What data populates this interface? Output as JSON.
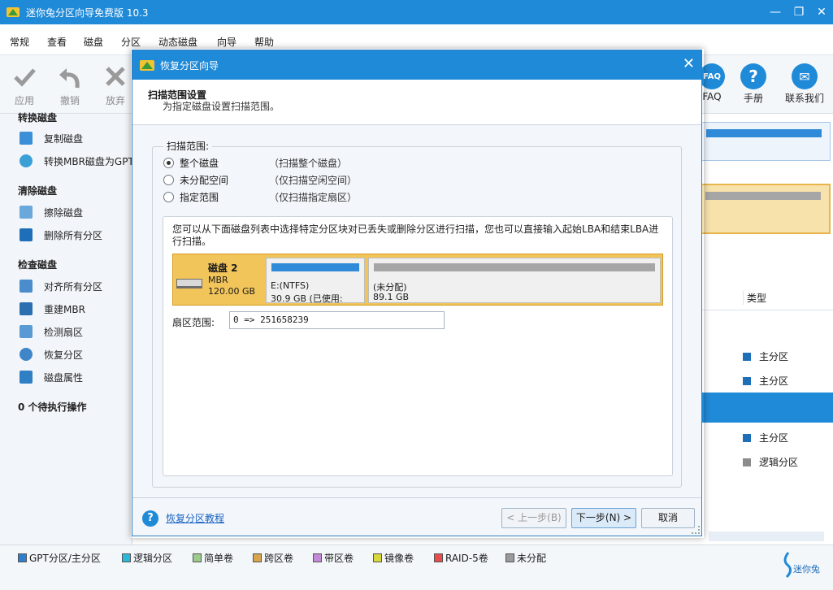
{
  "app": {
    "title": "迷你兔分区向导免费版 10.3",
    "brand_color": "#1f8ad8"
  },
  "menu": [
    "常规",
    "查看",
    "磁盘",
    "分区",
    "动态磁盘",
    "向导",
    "帮助"
  ],
  "toolbar": {
    "left": [
      {
        "label": "应用",
        "icon": "check-icon"
      },
      {
        "label": "撤销",
        "icon": "undo-icon"
      },
      {
        "label": "放弃",
        "icon": "discard-icon"
      }
    ],
    "right": [
      {
        "label": "FAQ",
        "icon": "faq-icon"
      },
      {
        "label": "手册",
        "icon": "help-icon"
      },
      {
        "label": "联系我们",
        "icon": "mail-icon"
      }
    ]
  },
  "left_panel": {
    "group_convert": "转换磁盘",
    "items_convert": [
      "复制磁盘",
      "转换MBR磁盘为GPT"
    ],
    "group_clean": "清除磁盘",
    "items_clean": [
      "擦除磁盘",
      "删除所有分区"
    ],
    "group_check": "检查磁盘",
    "items_check": [
      "对齐所有分区",
      "重建MBR",
      "检测扇区",
      "恢复分区",
      "磁盘属性"
    ],
    "pending": "0 个待执行操作"
  },
  "right_table": {
    "header_type": "类型",
    "rows": [
      {
        "type": "主分区",
        "color": "#1f6fb8"
      },
      {
        "type": "主分区",
        "color": "#1f6fb8"
      },
      {
        "type": "主分区",
        "color": "#1f6fb8"
      },
      {
        "type": "逻辑分区",
        "color": "#8c8c8c"
      }
    ]
  },
  "legend": [
    {
      "label": "GPT分区/主分区",
      "color": "#2f7fd0"
    },
    {
      "label": "逻辑分区",
      "color": "#2bb8d8"
    },
    {
      "label": "简单卷",
      "color": "#9ccc8c"
    },
    {
      "label": "跨区卷",
      "color": "#d6a54c"
    },
    {
      "label": "带区卷",
      "color": "#c38ad8"
    },
    {
      "label": "镜像卷",
      "color": "#d8d83a"
    },
    {
      "label": "RAID-5卷",
      "color": "#e84c4c"
    },
    {
      "label": "未分配",
      "color": "#9a9a9a"
    }
  ],
  "dialog": {
    "title": "恢复分区向导",
    "header_title": "扫描范围设置",
    "header_desc": "为指定磁盘设置扫描范围。",
    "scan_range_label": "扫描范围:",
    "options": [
      {
        "label": "整个磁盘",
        "desc": "（扫描整个磁盘）",
        "selected": true
      },
      {
        "label": "未分配空间",
        "desc": "（仅扫描空闲空间）",
        "selected": false
      },
      {
        "label": "指定范围",
        "desc": "（仅扫描指定扇区）",
        "selected": false
      }
    ],
    "info_text": "您可以从下面磁盘列表中选择特定分区块对已丢失或删除分区进行扫描，您也可以直接输入起始LBA和结束LBA进行扫描。",
    "disk": {
      "name": "磁盘 2",
      "type": "MBR",
      "size": "120.00 GB",
      "partitions": [
        {
          "line1": "E:(NTFS)",
          "line2": "30.9 GB (已使用:",
          "color": "#2f8ad8"
        },
        {
          "line1": "(未分配)",
          "line2": "89.1 GB",
          "color": "#a6a6a6"
        }
      ],
      "highlight_color": "#f2c55b"
    },
    "sector_label": "扇区范围:",
    "sector_value": "0 => 251658239",
    "help_link": "恢复分区教程",
    "btn_back": "< 上一步(B)",
    "btn_next": "下一步(N) >",
    "btn_cancel": "取消"
  }
}
